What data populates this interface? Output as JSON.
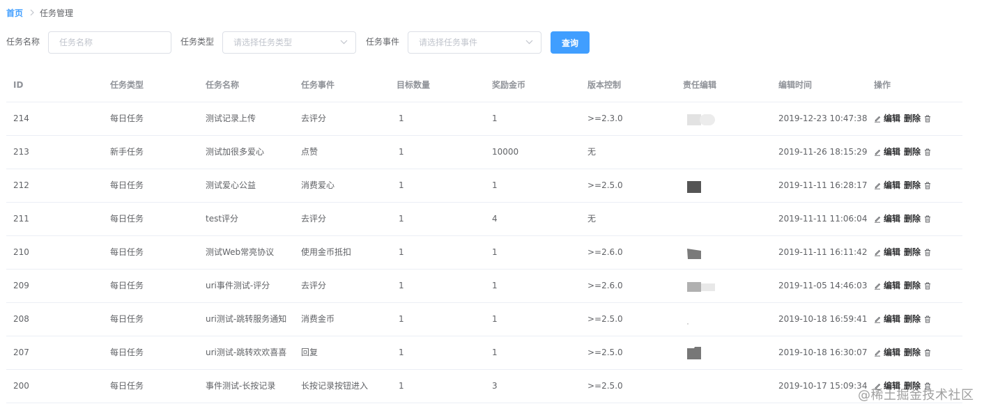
{
  "breadcrumb": {
    "home": "首页",
    "current": "任务管理"
  },
  "filters": {
    "name_label": "任务名称",
    "name_placeholder": "任务名称",
    "type_label": "任务类型",
    "type_placeholder": "请选择任务类型",
    "event_label": "任务事件",
    "event_placeholder": "请选择任务事件",
    "query_button": "查询"
  },
  "table": {
    "headers": [
      "ID",
      "任务类型",
      "任务名称",
      "任务事件",
      "目标数量",
      "奖励金币",
      "版本控制",
      "责任编辑",
      "编辑时间",
      "操作"
    ],
    "edit_label": "编辑",
    "delete_label": "删除",
    "rows": [
      {
        "id": "214",
        "type": "每日任务",
        "name": "测试记录上传",
        "event": "去评分",
        "target": "1",
        "reward": "1",
        "version": ">=2.3.0",
        "editor_avatar": "light-pill",
        "time": "2019-12-23 10:47:38"
      },
      {
        "id": "213",
        "type": "新手任务",
        "name": "测试加很多爱心",
        "event": "点赞",
        "target": "1",
        "reward": "10000",
        "version": "无",
        "editor_avatar": "none",
        "time": "2019-11-26 18:15:29"
      },
      {
        "id": "212",
        "type": "每日任务",
        "name": "测试爱心公益",
        "event": "消费爱心",
        "target": "1",
        "reward": "1",
        "version": ">=2.5.0",
        "editor_avatar": "dark-square",
        "time": "2019-11-11 16:28:17"
      },
      {
        "id": "211",
        "type": "每日任务",
        "name": "test评分",
        "event": "去评分",
        "target": "1",
        "reward": "4",
        "version": "无",
        "editor_avatar": "none",
        "time": "2019-11-11 11:06:04"
      },
      {
        "id": "210",
        "type": "每日任务",
        "name": "测试Web常亮协议",
        "event": "使用金币抵扣",
        "target": "1",
        "reward": "1",
        "version": ">=2.6.0",
        "editor_avatar": "gray-tilted",
        "time": "2019-11-11 16:11:42"
      },
      {
        "id": "209",
        "type": "每日任务",
        "name": "uri事件测试-评分",
        "event": "去评分",
        "target": "1",
        "reward": "1",
        "version": ">=2.6.0",
        "editor_avatar": "gray-gradient",
        "time": "2019-11-05 14:46:03"
      },
      {
        "id": "208",
        "type": "每日任务",
        "name": "uri测试-跳转服务通知",
        "event": "消费金币",
        "target": "1",
        "reward": "1",
        "version": ">=2.5.0",
        "editor_avatar": "dot",
        "time": "2019-10-18 16:59:41"
      },
      {
        "id": "207",
        "type": "每日任务",
        "name": "uri测试-跳转欢欢喜喜",
        "event": "回复",
        "target": "1",
        "reward": "1",
        "version": ">=2.5.0",
        "editor_avatar": "gray-folder",
        "time": "2019-10-18 16:30:07"
      },
      {
        "id": "200",
        "type": "每日任务",
        "name": "事件测试-长按记录",
        "event": "长按记录按钮进入",
        "target": "1",
        "reward": "3",
        "version": ">=2.5.0",
        "editor_avatar": "none",
        "time": "2019-10-17 15:09:34"
      }
    ]
  },
  "watermark": "@稀土掘金技术社区"
}
